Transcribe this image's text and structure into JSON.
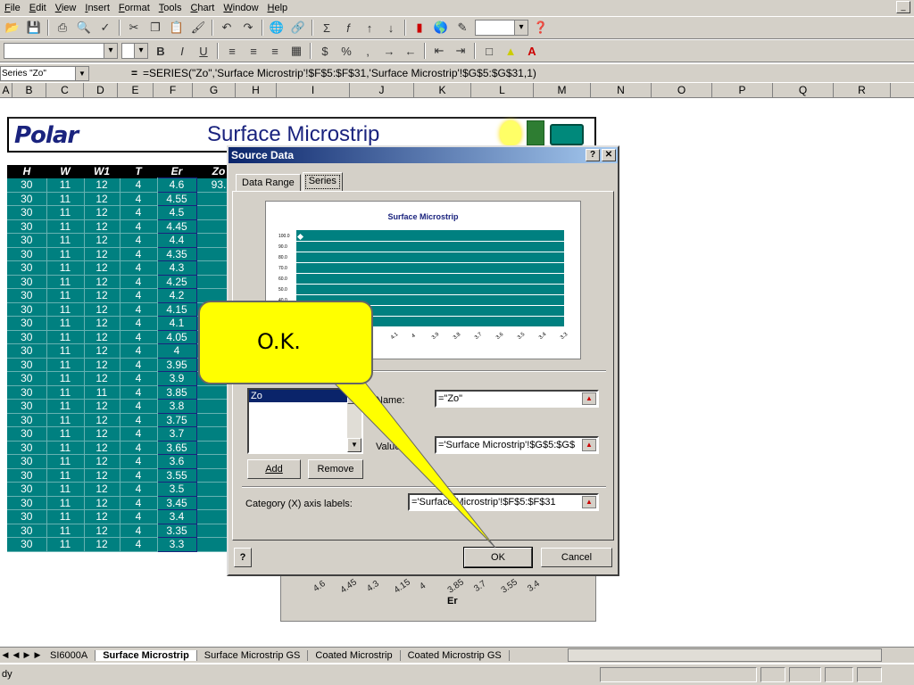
{
  "menu": [
    "File",
    "Edit",
    "View",
    "Insert",
    "Format",
    "Tools",
    "Chart",
    "Window",
    "Help"
  ],
  "formula_bar": {
    "name_box": "Series \"Zo\"",
    "equals": "=",
    "formula": "=SERIES(\"Zo\",'Surface Microstrip'!$F$5:$F$31,'Surface Microstrip'!$G$5:$G$31,1)"
  },
  "columns": [
    "A",
    "B",
    "C",
    "D",
    "E",
    "F",
    "G",
    "H",
    "I",
    "J",
    "K",
    "L",
    "M",
    "N",
    "O",
    "P",
    "Q",
    "R"
  ],
  "banner": {
    "logo": "Polar",
    "title": "Surface Microstrip"
  },
  "table": {
    "headers": [
      "H",
      "W",
      "W1",
      "T",
      "Er",
      "Zo"
    ],
    "first_zo": "93.",
    "rows": [
      [
        "30",
        "11",
        "12",
        "4",
        "4.6"
      ],
      [
        "30",
        "11",
        "12",
        "4",
        "4.55"
      ],
      [
        "30",
        "11",
        "12",
        "4",
        "4.5"
      ],
      [
        "30",
        "11",
        "12",
        "4",
        "4.45"
      ],
      [
        "30",
        "11",
        "12",
        "4",
        "4.4"
      ],
      [
        "30",
        "11",
        "12",
        "4",
        "4.35"
      ],
      [
        "30",
        "11",
        "12",
        "4",
        "4.3"
      ],
      [
        "30",
        "11",
        "12",
        "4",
        "4.25"
      ],
      [
        "30",
        "11",
        "12",
        "4",
        "4.2"
      ],
      [
        "30",
        "11",
        "12",
        "4",
        "4.15"
      ],
      [
        "30",
        "11",
        "12",
        "4",
        "4.1"
      ],
      [
        "30",
        "11",
        "12",
        "4",
        "4.05"
      ],
      [
        "30",
        "11",
        "12",
        "4",
        "4"
      ],
      [
        "30",
        "11",
        "12",
        "4",
        "3.95"
      ],
      [
        "30",
        "11",
        "12",
        "4",
        "3.9"
      ],
      [
        "30",
        "11",
        "11",
        "4",
        "3.85"
      ],
      [
        "30",
        "11",
        "12",
        "4",
        "3.8"
      ],
      [
        "30",
        "11",
        "12",
        "4",
        "3.75"
      ],
      [
        "30",
        "11",
        "12",
        "4",
        "3.7"
      ],
      [
        "30",
        "11",
        "12",
        "4",
        "3.65"
      ],
      [
        "30",
        "11",
        "12",
        "4",
        "3.6"
      ],
      [
        "30",
        "11",
        "12",
        "4",
        "3.55"
      ],
      [
        "30",
        "11",
        "12",
        "4",
        "3.5"
      ],
      [
        "30",
        "11",
        "12",
        "4",
        "3.45"
      ],
      [
        "30",
        "11",
        "12",
        "4",
        "3.4"
      ],
      [
        "30",
        "11",
        "12",
        "4",
        "3.35"
      ],
      [
        "30",
        "11",
        "12",
        "4",
        "3.3"
      ]
    ]
  },
  "chart_behind": {
    "ticks": [
      "4.6",
      "4.45",
      "4.3",
      "4.15",
      "4",
      "3.85",
      "3.7",
      "3.55",
      "3.4"
    ],
    "xlabel": "Er"
  },
  "dialog": {
    "title": "Source Data",
    "help_btn": "?",
    "close_btn": "✕",
    "tabs": [
      "Data Range",
      "Series"
    ],
    "preview_title": "Surface Microstrip",
    "series_label": "Series",
    "series_items": [
      "Zo"
    ],
    "name_label": "Name:",
    "name_value": "=\"Zo\"",
    "values_label": "Values:",
    "values_value": "='Surface Microstrip'!$G$5:$G$",
    "add_label": "Add",
    "remove_label": "Remove",
    "category_label": "Category (X) axis labels:",
    "category_value": "='Surface Microstrip'!$F$5:$F$31",
    "ok_label": "OK",
    "cancel_label": "Cancel"
  },
  "callout": {
    "text": "O.K."
  },
  "sheet_tabs": [
    "SI6000A",
    "Surface Microstrip",
    "Surface Microstrip GS",
    "Coated Microstrip",
    "Coated Microstrip GS"
  ],
  "status": "dy"
}
